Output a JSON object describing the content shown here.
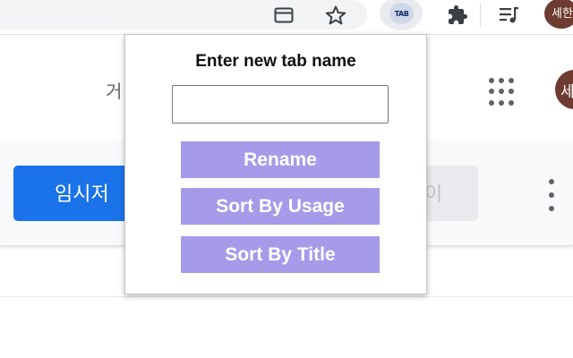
{
  "toolbar": {
    "icons": {
      "tab_search": "tab-search-icon",
      "bookmark": "star-outline-icon",
      "extension": "tab-renamer-extension-icon",
      "extensions_menu": "puzzle-piece-icon",
      "reading_list": "reading-list-icon"
    },
    "extension_logo_text": "TAB",
    "profile_label": "세한"
  },
  "page": {
    "header_text": "거",
    "avatar_letter": "세",
    "primary_button": "임시저",
    "field_text": "이",
    "apps_icon": "apps-grid-icon",
    "more_icon": "more-vert-icon"
  },
  "popup": {
    "title": "Enter new tab name",
    "input_value": "",
    "input_placeholder": "",
    "buttons": {
      "rename": "Rename",
      "sort_usage": "Sort By Usage",
      "sort_title": "Sort By Title"
    }
  },
  "colors": {
    "popup_button": "#a59be8",
    "page_primary": "#1a73e8",
    "profile": "#6d3b2f"
  }
}
